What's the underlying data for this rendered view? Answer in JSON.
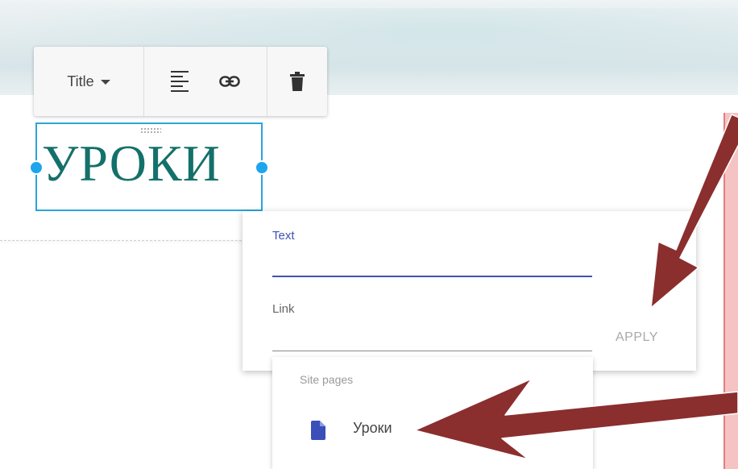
{
  "toolbar": {
    "style_label": "Title",
    "align_icon": "align-left-icon",
    "link_icon": "link-icon",
    "delete_icon": "trash-icon"
  },
  "title_element": {
    "text": "УРОКИ"
  },
  "link_dialog": {
    "text_label": "Text",
    "text_value": "",
    "link_label": "Link",
    "link_value": "",
    "apply_label": "APPLY"
  },
  "site_pages": {
    "heading": "Site pages",
    "items": [
      {
        "label": "Уроки",
        "icon": "document-icon"
      }
    ]
  },
  "colors": {
    "accent": "#3f51b5",
    "selection": "#2aa5d9",
    "title_text": "#14706a",
    "arrow": "#8b2e2e"
  }
}
